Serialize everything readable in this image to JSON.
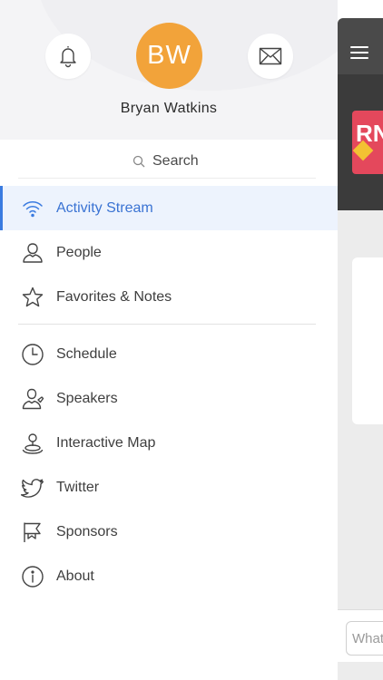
{
  "profile": {
    "initials": "BW",
    "name": "Bryan Watkins",
    "avatar_color": "#f2a33a"
  },
  "search": {
    "label": "Search"
  },
  "nav": {
    "primary": [
      {
        "label": "Activity Stream",
        "icon": "wifi-icon",
        "active": true
      },
      {
        "label": "People",
        "icon": "person-icon"
      },
      {
        "label": "Favorites & Notes",
        "icon": "star-icon"
      }
    ],
    "secondary": [
      {
        "label": "Schedule",
        "icon": "clock-icon"
      },
      {
        "label": "Speakers",
        "icon": "speaker-icon"
      },
      {
        "label": "Interactive Map",
        "icon": "map-pin-icon"
      },
      {
        "label": "Twitter",
        "icon": "twitter-icon"
      },
      {
        "label": "Sponsors",
        "icon": "flag-icon"
      },
      {
        "label": "About",
        "icon": "info-icon"
      }
    ]
  },
  "background_app": {
    "logo_text": "RN",
    "input_placeholder": "What"
  },
  "colors": {
    "accent": "#3a7be0",
    "active_bg": "#edf3fd",
    "topbar": "#4a4a4a"
  }
}
